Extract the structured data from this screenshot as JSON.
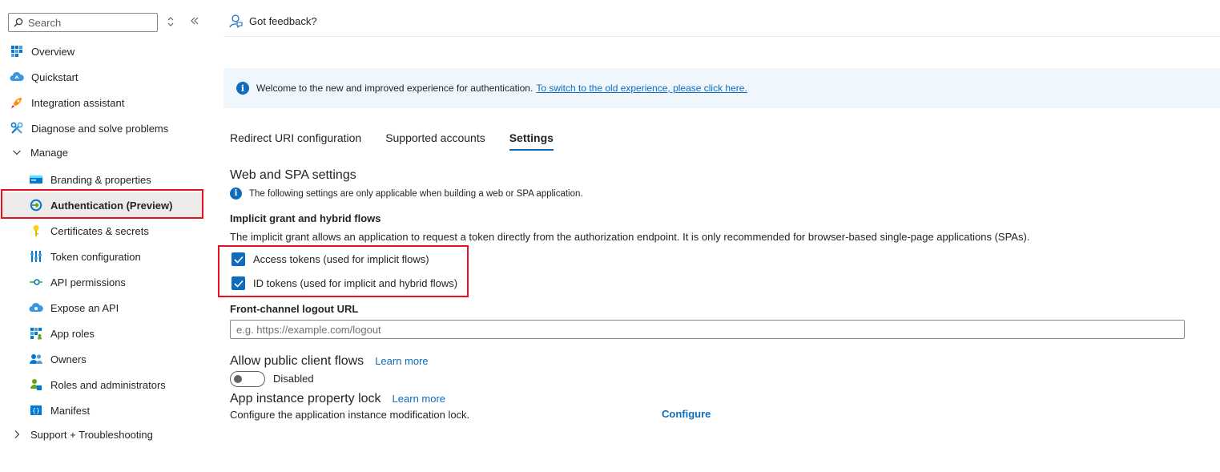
{
  "sidebar": {
    "search_placeholder": "Search",
    "items": [
      {
        "label": "Overview"
      },
      {
        "label": "Quickstart"
      },
      {
        "label": "Integration assistant"
      },
      {
        "label": "Diagnose and solve problems"
      },
      {
        "label": "Manage"
      },
      {
        "label": "Branding & properties"
      },
      {
        "label": "Authentication (Preview)"
      },
      {
        "label": "Certificates & secrets"
      },
      {
        "label": "Token configuration"
      },
      {
        "label": "API permissions"
      },
      {
        "label": "Expose an API"
      },
      {
        "label": "App roles"
      },
      {
        "label": "Owners"
      },
      {
        "label": "Roles and administrators"
      },
      {
        "label": "Manifest"
      },
      {
        "label": "Support + Troubleshooting"
      }
    ]
  },
  "header": {
    "feedback_label": "Got feedback?"
  },
  "banner": {
    "text": "Welcome to the new and improved experience for authentication.",
    "link": "To switch to the old experience, please click here."
  },
  "tabs": [
    {
      "label": "Redirect URI configuration"
    },
    {
      "label": "Supported accounts"
    },
    {
      "label": "Settings",
      "active": true
    }
  ],
  "web_spa": {
    "title": "Web and SPA settings",
    "note": "The following settings are only applicable when building a web or SPA application.",
    "implicit_title": "Implicit grant and hybrid flows",
    "implicit_desc": "The implicit grant allows an application to request a token directly from the authorization endpoint.  It is only recommended for browser-based single-page applications (SPAs).",
    "access_tokens_label": "Access tokens (used for implicit flows)",
    "access_tokens_checked": true,
    "id_tokens_label": "ID tokens (used for implicit and hybrid flows)",
    "id_tokens_checked": true,
    "logout_label": "Front-channel logout URL",
    "logout_placeholder": "e.g. https://example.com/logout"
  },
  "public_client": {
    "title": "Allow public client flows",
    "learn_more": "Learn more",
    "toggle_state": "Disabled"
  },
  "lock": {
    "title": "App instance property lock",
    "learn_more": "Learn more",
    "desc": "Configure the application instance modification lock.",
    "configure": "Configure"
  },
  "colors": {
    "accent": "#0f6cbd",
    "highlight": "#e81123",
    "selected_bg": "#edebe9"
  }
}
